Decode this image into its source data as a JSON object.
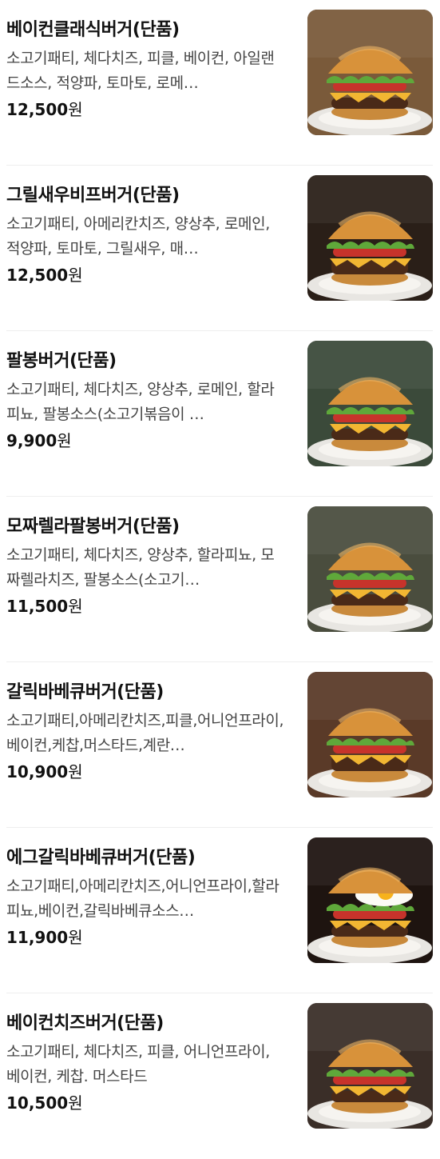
{
  "menu": {
    "items": [
      {
        "name": "베이컨클래식버거(단품)",
        "description": "소고기패티, 체다치즈, 피클, 베이컨, 아일랜드소스, 적양파, 토마토, 로메…",
        "price": "12,500",
        "currency": "원",
        "image_icon": "burger-photo",
        "bg": "#7a5a3a"
      },
      {
        "name": "그릴새우비프버거(단품)",
        "description": "소고기패티, 아메리칸치즈, 양상추, 로메인, 적양파, 토마토, 그릴새우, 매…",
        "price": "12,500",
        "currency": "원",
        "image_icon": "burger-photo",
        "bg": "#2a1f18"
      },
      {
        "name": "팔봉버거(단품)",
        "description": "소고기패티, 체다치즈, 양상추, 로메인, 할라피뇨, 팔봉소스(소고기볶음이 …",
        "price": "9,900",
        "currency": "원",
        "image_icon": "burger-photo",
        "bg": "#3b4a3a"
      },
      {
        "name": "모짜렐라팔봉버거(단품)",
        "description": "소고기패티, 체다치즈, 양상추, 할라피뇨, 모짜렐라치즈, 팔봉소스(소고기…",
        "price": "11,500",
        "currency": "원",
        "image_icon": "burger-photo",
        "bg": "#4a4d3e"
      },
      {
        "name": "갈릭바베큐버거(단품)",
        "description": "소고기패티,아메리칸치즈,피클,어니언프라이, 베이컨,케찹,머스타드,계란…",
        "price": "10,900",
        "currency": "원",
        "image_icon": "burger-photo",
        "bg": "#5a3a28"
      },
      {
        "name": "에그갈릭바베큐버거(단품)",
        "description": "소고기패티,아메리칸치즈,어니언프라이,할라피뇨,베이컨,갈릭바베큐소스…",
        "price": "11,900",
        "currency": "원",
        "image_icon": "burger-photo",
        "bg": "#1e1410"
      },
      {
        "name": "베이컨치즈버거(단품)",
        "description": "소고기패티, 체다치즈, 피클, 어니언프라이, 베이컨, 케찹. 머스타드",
        "price": "10,500",
        "currency": "원",
        "image_icon": "burger-photo",
        "bg": "#3a2e28"
      }
    ]
  }
}
